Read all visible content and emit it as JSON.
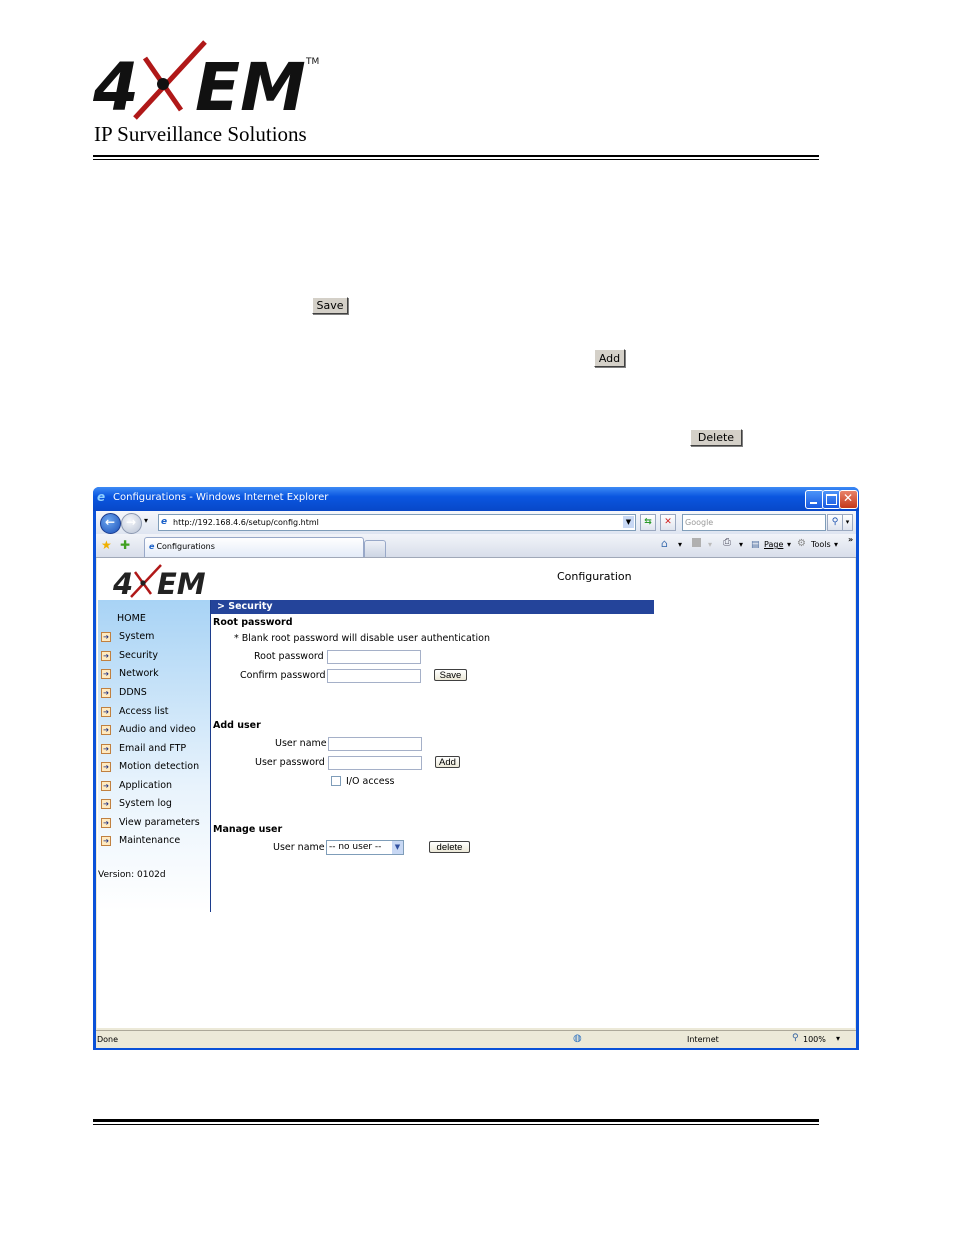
{
  "document": {
    "brand": "4XEM",
    "trademark": "TM",
    "tagline": "IP Surveillance Solutions",
    "buttons": {
      "save": "Save",
      "add": "Add",
      "delete": "Delete"
    }
  },
  "browser": {
    "window_title": "Configurations - Windows Internet Explorer",
    "address": "http://192.168.4.6/setup/config.html",
    "search_placeholder": "Google",
    "tab_label": "Configurations",
    "commands": {
      "page": "Page",
      "tools": "Tools",
      "more": "»"
    },
    "status": {
      "text": "Done",
      "zone": "Internet",
      "zoom": "100%"
    },
    "icons": [
      "back-icon",
      "forward-icon",
      "refresh-icon",
      "stop-icon",
      "search-icon",
      "favorites-star-icon",
      "add-favorites-icon",
      "home-icon",
      "feeds-icon",
      "print-icon",
      "page-icon",
      "tools-gear-icon",
      "globe-icon",
      "zoom-icon"
    ]
  },
  "page": {
    "logo": "4XEM",
    "heading": "Configuration",
    "section_title": "> Security",
    "sidebar": {
      "home": "HOME",
      "items": [
        {
          "label": "System"
        },
        {
          "label": "Security"
        },
        {
          "label": "Network"
        },
        {
          "label": "DDNS"
        },
        {
          "label": "Access list"
        },
        {
          "label": "Audio and video"
        },
        {
          "label": "Email and FTP"
        },
        {
          "label": "Motion detection"
        },
        {
          "label": "Application"
        },
        {
          "label": "System log"
        },
        {
          "label": "View parameters"
        },
        {
          "label": "Maintenance"
        }
      ],
      "version": "Version: 0102d"
    },
    "root_password": {
      "title": "Root password",
      "note": "* Blank root password will disable user authentication",
      "root_label": "Root password",
      "root_value": "",
      "confirm_label": "Confirm password",
      "confirm_value": "",
      "save_label": "Save"
    },
    "add_user": {
      "title": "Add user",
      "name_label": "User name",
      "name_value": "",
      "password_label": "User password",
      "password_value": "",
      "add_label": "Add",
      "io_label": "I/O access",
      "io_checked": false
    },
    "manage_user": {
      "title": "Manage user",
      "name_label": "User name",
      "selected": "-- no user --",
      "delete_label": "delete"
    }
  }
}
